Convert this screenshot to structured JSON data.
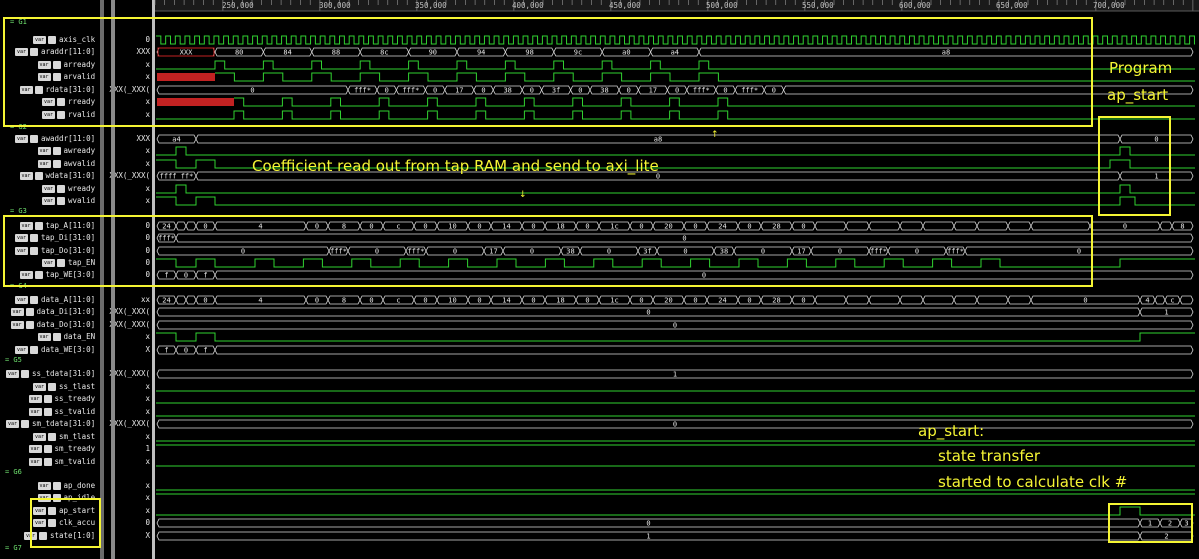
{
  "ruler": {
    "labels": [
      "250,000",
      "300,000",
      "350,000",
      "400,000",
      "450,000",
      "500,000",
      "550,000",
      "600,000",
      "650,000",
      "700,000"
    ]
  },
  "groups": [
    "G1",
    "G2",
    "G3",
    "G4",
    "G5",
    "G6",
    "G7"
  ],
  "signals": [
    {
      "name": "axis_clk",
      "badge": "var",
      "value": "0"
    },
    {
      "name": "araddr[11:0]",
      "badge": "var",
      "value": "XXX"
    },
    {
      "name": "arready",
      "badge": "var",
      "value": "x"
    },
    {
      "name": "arvalid",
      "badge": "var",
      "value": "x"
    },
    {
      "name": "rdata[31:0]",
      "badge": "var",
      "value": "XXX(_XXX("
    },
    {
      "name": "rready",
      "badge": "var",
      "value": "x"
    },
    {
      "name": "rvalid",
      "badge": "var",
      "value": "x"
    },
    {
      "name": "awaddr[11:0]",
      "badge": "var",
      "value": "XXX"
    },
    {
      "name": "awready",
      "badge": "var",
      "value": "x"
    },
    {
      "name": "awvalid",
      "badge": "var",
      "value": "x"
    },
    {
      "name": "wdata[31:0]",
      "badge": "var",
      "value": "XXX(_XXX("
    },
    {
      "name": "wready",
      "badge": "var",
      "value": "x"
    },
    {
      "name": "wvalid",
      "badge": "var",
      "value": "x"
    },
    {
      "name": "tap_A[11:0]",
      "badge": "var",
      "value": "0"
    },
    {
      "name": "tap_Di[31:0]",
      "badge": "var",
      "value": "0"
    },
    {
      "name": "tap_Do[31:0]",
      "badge": "var",
      "value": "0"
    },
    {
      "name": "tap_EN",
      "badge": "var",
      "value": "0"
    },
    {
      "name": "tap_WE[3:0]",
      "badge": "var",
      "value": "0"
    },
    {
      "name": "data_A[11:0]",
      "badge": "var",
      "value": "xx"
    },
    {
      "name": "data_Di[31:0]",
      "badge": "var",
      "value": "XXX(_XXX("
    },
    {
      "name": "data_Do[31:0]",
      "badge": "var",
      "value": "XXX(_XXX("
    },
    {
      "name": "data_EN",
      "badge": "var",
      "value": "x"
    },
    {
      "name": "data_WE[3:0]",
      "badge": "var",
      "value": "X"
    },
    {
      "name": "ss_tdata[31:0]",
      "badge": "var",
      "value": "XXX(_XXX("
    },
    {
      "name": "ss_tlast",
      "badge": "var",
      "value": "x"
    },
    {
      "name": "ss_tready",
      "badge": "var",
      "value": "x"
    },
    {
      "name": "ss_tvalid",
      "badge": "var",
      "value": "x"
    },
    {
      "name": "sm_tdata[31:0]",
      "badge": "var",
      "value": "XXX(_XXX("
    },
    {
      "name": "sm_tlast",
      "badge": "var",
      "value": "x"
    },
    {
      "name": "sm_tready",
      "badge": "var",
      "value": "1"
    },
    {
      "name": "sm_tvalid",
      "badge": "var",
      "value": "x"
    },
    {
      "name": "ap_done",
      "badge": "var",
      "value": "x"
    },
    {
      "name": "ap_idle",
      "badge": "var",
      "value": "x"
    },
    {
      "name": "ap_start",
      "badge": "var",
      "value": "x"
    },
    {
      "name": "clk_accu",
      "badge": "var",
      "value": "0"
    },
    {
      "name": "state[1:0]",
      "badge": "var",
      "value": "X"
    }
  ],
  "bus_values": {
    "araddr": [
      "XXX",
      "80",
      "84",
      "88",
      "8c",
      "90",
      "94",
      "98",
      "9c",
      "a0",
      "a4",
      "a8"
    ],
    "rdata": [
      "0",
      "fff*",
      "0",
      "fff*",
      "0",
      "17",
      "0",
      "38",
      "0",
      "3f",
      "0",
      "38",
      "0",
      "17",
      "0",
      "fff*",
      "0",
      "fff*",
      "0"
    ],
    "awaddr": [
      "a4",
      "a8",
      "0"
    ],
    "wdata": [
      "ffff_ff*",
      "0",
      "1"
    ],
    "tap_A": [
      "24",
      "0",
      "28",
      "0",
      "4",
      "0",
      "8",
      "0",
      "c",
      "0",
      "10",
      "0",
      "14",
      "0",
      "18",
      "0",
      "1c",
      "0",
      "20",
      "0",
      "24",
      "0",
      "28",
      "0",
      "4",
      "8"
    ],
    "tap_Di": [
      "fff*",
      "0"
    ],
    "tap_Do": [
      "0",
      "fff*",
      "0",
      "fff*",
      "0",
      "17",
      "0",
      "38",
      "0",
      "3f",
      "0",
      "38",
      "0",
      "17",
      "0",
      "fff*",
      "0",
      "fff*",
      "0"
    ],
    "tap_WE": [
      "f",
      "0",
      "f",
      "0"
    ],
    "data_A": [
      "24",
      "0",
      "28",
      "0",
      "4",
      "0",
      "8",
      "0",
      "c",
      "0",
      "10",
      "0",
      "14",
      "0",
      "18",
      "0",
      "1c",
      "0",
      "20",
      "0",
      "24",
      "0",
      "28",
      "0",
      "4",
      "8",
      "c"
    ],
    "data_Di": [
      "0",
      "1"
    ],
    "data_Do": [
      "0"
    ],
    "data_WE": [
      "f",
      "0",
      "f"
    ],
    "ss_tdata": [
      "1"
    ],
    "sm_tdata": [
      "0"
    ],
    "clk_accu": [
      "0",
      "1",
      "2",
      "3"
    ],
    "state": [
      "1",
      "2"
    ]
  },
  "annotations": {
    "coef": "Coefficient read out from tap RAM and send to axi_lite",
    "program_line1": "Program",
    "program_line2": "ap_start",
    "ap_line1": "ap_start:",
    "ap_line2": "state transfer",
    "ap_line3": "started to calculate clk #"
  },
  "colors": {
    "wave": "#31d231",
    "bus": "#d9d9d9",
    "undefined": "#c22222",
    "highlight": "#f5f534",
    "bus_text": "#e8e8e8"
  }
}
